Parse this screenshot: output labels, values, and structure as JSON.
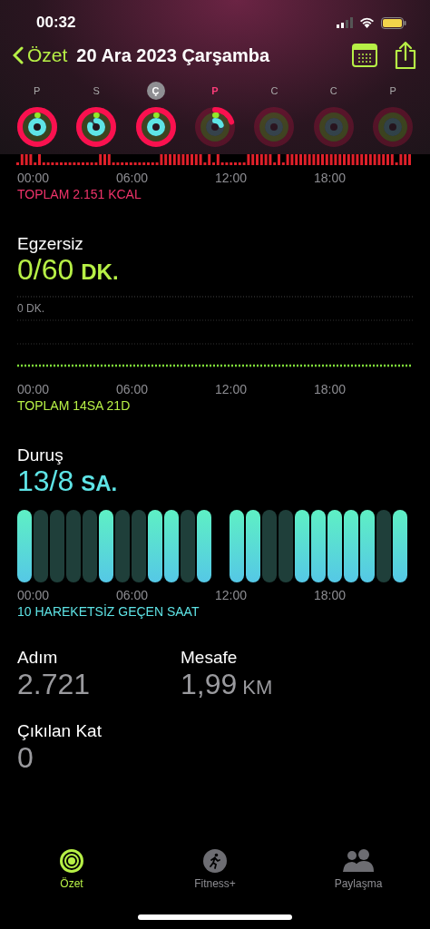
{
  "status_bar": {
    "time": "00:32"
  },
  "nav": {
    "back": "Özet",
    "title": "20 Ara 2023 Çarşamba"
  },
  "week": [
    {
      "label": "P",
      "selected": false,
      "today": false,
      "kind": "closed"
    },
    {
      "label": "S",
      "selected": false,
      "today": false,
      "kind": "partial"
    },
    {
      "label": "Ç",
      "selected": true,
      "today": false,
      "kind": "closed"
    },
    {
      "label": "P",
      "selected": false,
      "today": true,
      "kind": "started"
    },
    {
      "label": "C",
      "selected": false,
      "today": false,
      "kind": "empty"
    },
    {
      "label": "C",
      "selected": false,
      "today": false,
      "kind": "empty"
    },
    {
      "label": "P",
      "selected": false,
      "today": false,
      "kind": "empty"
    }
  ],
  "move": {
    "axis": [
      "00:00",
      "06:00",
      "12:00",
      "18:00"
    ],
    "total": "TOPLAM 2.151 KCAL"
  },
  "exercise": {
    "title": "Egzersiz",
    "value": "0/60",
    "unit": "DK.",
    "chart_label": "0 DK.",
    "axis": [
      "00:00",
      "06:00",
      "12:00",
      "18:00"
    ],
    "total": "TOPLAM 14SA 21D"
  },
  "stand": {
    "title": "Duruş",
    "value": "13/8",
    "unit": "SA.",
    "hours": [
      {
        "kind": "bar",
        "stood": true
      },
      {
        "kind": "bar",
        "stood": false
      },
      {
        "kind": "bar",
        "stood": false
      },
      {
        "kind": "bar",
        "stood": false
      },
      {
        "kind": "bar",
        "stood": false
      },
      {
        "kind": "bar",
        "stood": true
      },
      {
        "kind": "bar",
        "stood": false
      },
      {
        "kind": "bar",
        "stood": false
      },
      {
        "kind": "bar",
        "stood": true
      },
      {
        "kind": "bar",
        "stood": true
      },
      {
        "kind": "bar",
        "stood": false
      },
      {
        "kind": "bar",
        "stood": true
      },
      {
        "kind": "gap"
      },
      {
        "kind": "bar",
        "stood": true
      },
      {
        "kind": "bar",
        "stood": true
      },
      {
        "kind": "bar",
        "stood": false
      },
      {
        "kind": "bar",
        "stood": false
      },
      {
        "kind": "bar",
        "stood": true
      },
      {
        "kind": "bar",
        "stood": true
      },
      {
        "kind": "bar",
        "stood": true
      },
      {
        "kind": "bar",
        "stood": true
      },
      {
        "kind": "bar",
        "stood": true
      },
      {
        "kind": "bar",
        "stood": false
      },
      {
        "kind": "bar",
        "stood": true
      }
    ],
    "axis": [
      "00:00",
      "06:00",
      "12:00",
      "18:00"
    ],
    "total": "10 HAREKETSİZ GEÇEN SAAT"
  },
  "stats": [
    {
      "label": "Adım",
      "value": "2.721"
    },
    {
      "label": "Mesafe",
      "value": "1,99",
      "unit": "KM"
    }
  ],
  "floors": {
    "label": "Çıkılan Kat",
    "value": "0"
  },
  "tabs": [
    {
      "label": "Özet",
      "selected": true,
      "kind": "summary"
    },
    {
      "label": "Fitness+",
      "selected": false,
      "kind": "fitness"
    },
    {
      "label": "Paylaşma",
      "selected": false,
      "kind": "sharing"
    }
  ]
}
